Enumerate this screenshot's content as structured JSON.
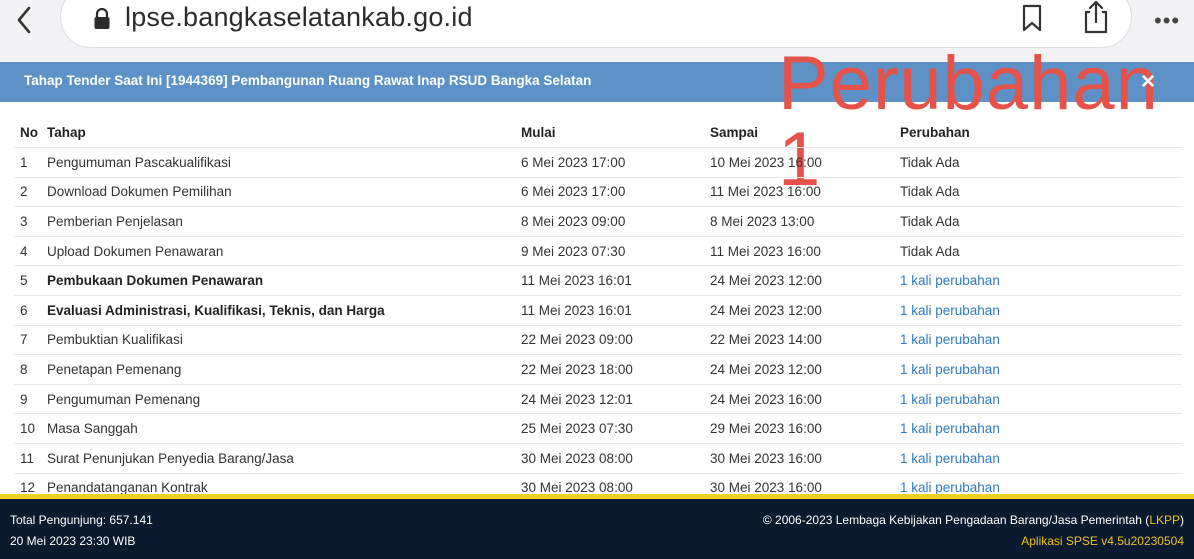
{
  "browser": {
    "url": "lpse.bangkaselatankab.go.id"
  },
  "panel": {
    "title": "Tahap Tender Saat Ini [1944369] Pembangunan Ruang Rawat Inap RSUD Bangka Selatan",
    "overlay_annotation": "Perubahan 1",
    "close_symbol": "×"
  },
  "table": {
    "columns": {
      "no": "No",
      "tahap": "Tahap",
      "mulai": "Mulai",
      "sampai": "Sampai",
      "perubahan": "Perubahan"
    },
    "rows": [
      {
        "no": "1",
        "tahap": "Pengumuman Pascakualifikasi",
        "mulai": "6 Mei 2023 17:00",
        "sampai": "10 Mei 2023 16:00",
        "perubahan": "Tidak Ada"
      },
      {
        "no": "2",
        "tahap": "Download Dokumen Pemilihan",
        "mulai": "6 Mei 2023 17:00",
        "sampai": "11 Mei 2023 16:00",
        "perubahan": "Tidak Ada"
      },
      {
        "no": "3",
        "tahap": "Pemberian Penjelasan",
        "mulai": "8 Mei 2023 09:00",
        "sampai": "8 Mei 2023 13:00",
        "perubahan": "Tidak Ada"
      },
      {
        "no": "4",
        "tahap": "Upload Dokumen Penawaran",
        "mulai": "9 Mei 2023 07:30",
        "sampai": "11 Mei 2023 16:00",
        "perubahan": "Tidak Ada"
      },
      {
        "no": "5",
        "tahap": "Pembukaan Dokumen Penawaran",
        "mulai": "11 Mei 2023 16:01",
        "sampai": "24 Mei 2023 12:00",
        "perubahan": "1 kali perubahan"
      },
      {
        "no": "6",
        "tahap": "Evaluasi Administrasi, Kualifikasi, Teknis, dan Harga",
        "mulai": "11 Mei 2023 16:01",
        "sampai": "24 Mei 2023 12:00",
        "perubahan": "1 kali perubahan"
      },
      {
        "no": "7",
        "tahap": "Pembuktian Kualifikasi",
        "mulai": "22 Mei 2023 09:00",
        "sampai": "22 Mei 2023 14:00",
        "perubahan": "1 kali perubahan"
      },
      {
        "no": "8",
        "tahap": "Penetapan Pemenang",
        "mulai": "22 Mei 2023 18:00",
        "sampai": "24 Mei 2023 12:00",
        "perubahan": "1 kali perubahan"
      },
      {
        "no": "9",
        "tahap": "Pengumuman Pemenang",
        "mulai": "24 Mei 2023 12:01",
        "sampai": "24 Mei 2023 16:00",
        "perubahan": "1 kali perubahan"
      },
      {
        "no": "10",
        "tahap": "Masa Sanggah",
        "mulai": "25 Mei 2023 07:30",
        "sampai": "29 Mei 2023 16:00",
        "perubahan": "1 kali perubahan"
      },
      {
        "no": "11",
        "tahap": "Surat Penunjukan Penyedia Barang/Jasa",
        "mulai": "30 Mei 2023 08:00",
        "sampai": "30 Mei 2023 16:00",
        "perubahan": "1 kali perubahan"
      },
      {
        "no": "12",
        "tahap": "Penandatanganan Kontrak",
        "mulai": "30 Mei 2023 08:00",
        "sampai": "30 Mei 2023 16:00",
        "perubahan": "1 kali perubahan"
      }
    ]
  },
  "footer": {
    "visitors": "Total Pengunjung: 657.141",
    "datetime": "20 Mei 2023 23:30 WIB",
    "copyright_prefix": "© 2006-2023 Lembaga Kebijakan Pengadaan Barang/Jasa Pemerintah (",
    "copyright_link": "LKPP",
    "copyright_suffix": ")",
    "version": "Aplikasi SPSE v4.5u20230504"
  },
  "colors": {
    "header_bar": "#5e92c6",
    "link": "#2f79c6",
    "overlay_annotation": "#e4524a",
    "footer_bg": "#0b1a2e",
    "footer_accent": "#f0c21c"
  }
}
